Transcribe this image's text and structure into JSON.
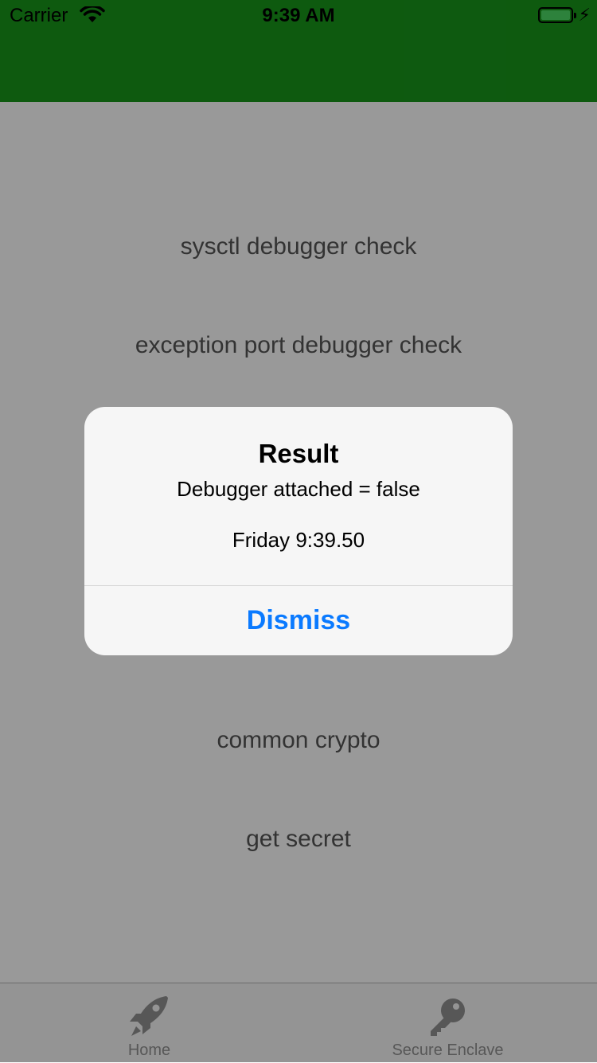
{
  "colors": {
    "nav_bar": "#18961a",
    "alert_button": "#0a7aff",
    "tab_inactive": "#929292"
  },
  "status_bar": {
    "carrier": "Carrier",
    "time": "9:39 AM",
    "wifi_icon": "wifi-icon",
    "battery_icon": "battery-icon",
    "charging_icon": "charging-bolt-icon"
  },
  "menu": {
    "items": [
      {
        "label": "sysctl debugger check"
      },
      {
        "label": "exception port debugger check"
      },
      {
        "label": "common crypto"
      },
      {
        "label": "get secret"
      }
    ]
  },
  "alert": {
    "title": "Result",
    "message": "Debugger attached = false",
    "timestamp": "Friday 9:39.50",
    "button": "Dismiss"
  },
  "tab_bar": {
    "tabs": [
      {
        "label": "Home",
        "icon": "rocket-icon"
      },
      {
        "label": "Secure Enclave",
        "icon": "key-icon"
      }
    ]
  }
}
